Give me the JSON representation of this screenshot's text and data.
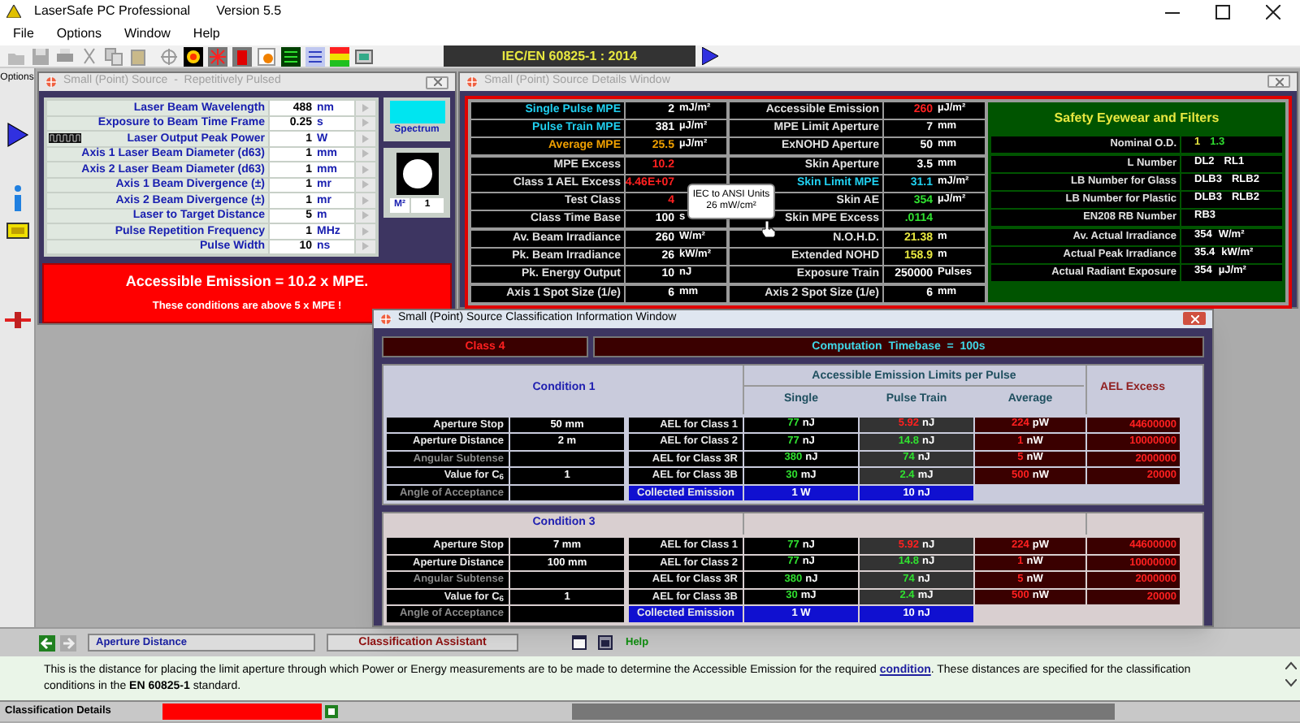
{
  "window": {
    "title": "LaserSafe PC Professional",
    "version": "Version 5.5"
  },
  "menu": [
    "File",
    "Options",
    "Window",
    "Help"
  ],
  "toolbar": {
    "standard": "IEC/EN 60825-1 : 2014"
  },
  "sidebar": {
    "label": "Options"
  },
  "source_window": {
    "title": "Small (Point) Source  -  Repetitively Pulsed",
    "parameters": [
      {
        "kind": "plain",
        "label": "Laser Beam Wavelength",
        "value": "488",
        "unit": "nm"
      },
      {
        "kind": "plain",
        "label": "Exposure to Beam Time Frame",
        "value": "0.25",
        "unit": "s"
      },
      {
        "kind": "pulse",
        "label": "Laser Output Peak Power",
        "value": "1",
        "unit": "W"
      },
      {
        "kind": "plain",
        "label": "Axis 1 Laser Beam Diameter (d63)",
        "value": "1",
        "unit": "mm"
      },
      {
        "kind": "plain",
        "label": "Axis 2 Laser Beam Diameter (d63)",
        "value": "1",
        "unit": "mm"
      },
      {
        "kind": "plain",
        "label": "Axis 1 Beam Divergence (±)",
        "value": "1",
        "unit": "mr"
      },
      {
        "kind": "plain",
        "label": "Axis 2 Beam Divergence (±)",
        "value": "1",
        "unit": "mr"
      },
      {
        "kind": "plain",
        "label": "Laser to Target Distance",
        "value": "5",
        "unit": "m"
      },
      {
        "kind": "plain",
        "label": "Pulse Repetition Frequency",
        "value": "1",
        "unit": "MHz"
      },
      {
        "kind": "plain",
        "label": "Pulse Width",
        "value": "10",
        "unit": "ns"
      }
    ],
    "spectrum": {
      "label": "Spectrum",
      "color": "#00e5f0"
    },
    "m2": {
      "label": "M²",
      "value": "1"
    },
    "alert": {
      "headline": "Accessible Emission = 10.2 x MPE.",
      "message": "These conditions are above 5 x MPE !"
    }
  },
  "details_window": {
    "title": "Small (Point) Source Details Window",
    "columns": [
      [
        [
          {
            "label": {
              "text": "Single Pulse MPE",
              "color": "#20d0f0"
            },
            "value": {
              "text": "2",
              "color": "#ffffff"
            },
            "unit": "mJ/m²"
          },
          {
            "label": {
              "text": "Pulse Train MPE",
              "color": "#20d0f0"
            },
            "value": {
              "text": "381",
              "color": "#ffffff"
            },
            "unit": "µJ/m²"
          },
          {
            "label": {
              "text": "Average MPE",
              "color": "#f0a000"
            },
            "value": {
              "text": "25.5",
              "color": "#f0a000"
            },
            "unit": "µJ/m²"
          }
        ],
        [
          {
            "label": {
              "text": "MPE Excess",
              "color": "#e0e0e0"
            },
            "value": {
              "text": "10.2",
              "color": "#ff2020"
            }
          },
          {
            "label": {
              "text": "Class 1 AEL Excess",
              "color": "#e0e0e0"
            },
            "value": {
              "text": "4.46E+07",
              "color": "#ff2020"
            }
          },
          {
            "label": {
              "text": "Test Class",
              "color": "#e0e0e0"
            },
            "value": {
              "text": "4",
              "color": "#ff2020"
            }
          },
          {
            "label": {
              "text": "Class Time Base",
              "color": "#e0e0e0"
            },
            "value": {
              "text": "100",
              "color": "#ffffff"
            },
            "unit": "s"
          }
        ],
        [
          {
            "label": {
              "text": "Av. Beam Irradiance",
              "color": "#e0e0e0"
            },
            "value": {
              "text": "260",
              "color": "#ffffff"
            },
            "unit": "W/m²"
          },
          {
            "label": {
              "text": "Pk. Beam Irradiance",
              "color": "#e0e0e0"
            },
            "value": {
              "text": "26",
              "color": "#ffffff"
            },
            "unit": "kW/m²"
          },
          {
            "label": {
              "text": "Pk. Energy Output",
              "color": "#e0e0e0"
            },
            "value": {
              "text": "10",
              "color": "#ffffff"
            },
            "unit": "nJ"
          }
        ],
        [
          {
            "label": {
              "text": "Axis 1 Spot Size  (1/e)",
              "color": "#e0e0e0"
            },
            "value": {
              "text": "6",
              "color": "#ffffff"
            },
            "unit": "mm"
          }
        ]
      ],
      [
        [
          {
            "label": {
              "text": "Accessible Emission",
              "color": "#e0e0e0"
            },
            "value": {
              "text": "260",
              "color": "#ff2020"
            },
            "unit": "µJ/m²"
          },
          {
            "label": {
              "text": "MPE Limit Aperture",
              "color": "#e0e0e0"
            },
            "value": {
              "text": "7",
              "color": "#ffffff"
            },
            "unit": "mm"
          },
          {
            "label": {
              "text": "ExNOHD Aperture",
              "color": "#e0e0e0"
            },
            "value": {
              "text": "50",
              "color": "#ffffff"
            },
            "unit": "mm"
          }
        ],
        [
          {
            "label": {
              "text": "Skin Aperture",
              "color": "#e0e0e0"
            },
            "value": {
              "text": "3.5",
              "color": "#ffffff"
            },
            "unit": "mm"
          },
          {
            "label": {
              "text": "Skin Limit MPE",
              "color": "#20d0f0"
            },
            "value": {
              "text": "31.1",
              "color": "#20d0f0"
            },
            "unit": "mJ/m²"
          },
          {
            "label": {
              "text": "Skin AE",
              "color": "#e0e0e0"
            },
            "value": {
              "text": "354",
              "color": "#30e030"
            },
            "unit": "µJ/m²"
          },
          {
            "label": {
              "text": "Skin MPE Excess",
              "color": "#e0e0e0"
            },
            "value": {
              "text": ".0114",
              "color": "#30e030"
            }
          }
        ],
        [
          {
            "label": {
              "text": "N.O.H.D.",
              "color": "#e0e0e0"
            },
            "value": {
              "text": "21.38",
              "color": "#e8e840"
            },
            "unit": "m"
          },
          {
            "label": {
              "text": "Extended NOHD",
              "color": "#e0e0e0"
            },
            "value": {
              "text": "158.9",
              "color": "#e8e840"
            },
            "unit": "m"
          },
          {
            "label": {
              "text": "Exposure Train",
              "color": "#e0e0e0"
            },
            "value": {
              "text": "250000",
              "color": "#ffffff"
            },
            "unit": "Pulses"
          }
        ],
        [
          {
            "label": {
              "text": "Axis 2 Spot Size  (1/e)",
              "color": "#e0e0e0"
            },
            "value": {
              "text": "6",
              "color": "#ffffff"
            },
            "unit": "mm"
          }
        ]
      ]
    ],
    "eyewear": {
      "title": "Safety Eyewear and Filters",
      "groups": [
        [
          {
            "label": "Nominal O.D.",
            "values": [
              {
                "text": "1",
                "color": "#e8e840"
              },
              {
                "text": "1.3",
                "color": "#30e030"
              }
            ]
          }
        ],
        [
          {
            "label": "L Number",
            "values": [
              {
                "text": "DL2",
                "color": "#ffffff"
              },
              {
                "text": "RL1",
                "color": "#ffffff"
              }
            ]
          },
          {
            "label": "LB Number for Glass",
            "values": [
              {
                "text": "DLB3",
                "color": "#ffffff"
              },
              {
                "text": "RLB2",
                "color": "#ffffff"
              }
            ]
          },
          {
            "label": "LB Number for Plastic",
            "values": [
              {
                "text": "DLB3",
                "color": "#ffffff"
              },
              {
                "text": "RLB2",
                "color": "#ffffff"
              }
            ]
          },
          {
            "label": "EN208 RB Number",
            "values": [
              {
                "text": "RB3",
                "color": "#ffffff"
              }
            ]
          }
        ],
        [
          {
            "label": "Av. Actual Irradiance",
            "values": [
              {
                "text": "354",
                "color": "#ffffff"
              }
            ],
            "unit": "W/m²"
          },
          {
            "label": "Actual Peak Irradiance",
            "values": [
              {
                "text": "35.4",
                "color": "#ffffff"
              }
            ],
            "unit": "kW/m²"
          },
          {
            "label": "Actual Radiant Exposure",
            "values": [
              {
                "text": "354",
                "color": "#ffffff"
              }
            ],
            "unit": "µJ/m²"
          }
        ]
      ]
    },
    "tooltip": {
      "title": "IEC to ANSI Units",
      "value": "26 mW/cm²"
    }
  },
  "classification_window": {
    "title": "Small (Point) Source Classification Information Window",
    "class": "Class 4",
    "timebase": "Computation  Timebase  =  100s",
    "conditions": [
      {
        "title": "Condition 1",
        "color": "#c9cbdc",
        "limits_header": "Accessible Emission Limits per Pulse",
        "columns": [
          "Single",
          "Pulse Train",
          "Average"
        ],
        "excess_header": "AEL Excess",
        "params": [
          {
            "label": "Aperture Stop",
            "value": "50 mm",
            "disabled": false
          },
          {
            "label": "Aperture Distance",
            "value": "2 m",
            "disabled": false
          },
          {
            "label": "Angular Subtense",
            "disabled": true
          },
          {
            "label": "Value for C$_{6}$",
            "value": "1",
            "disabled": false
          },
          {
            "label": "Angle of Acceptance",
            "disabled": true
          }
        ],
        "ael": [
          {
            "label": "AEL for Class 1",
            "single": {
              "value": "77",
              "unit": "nJ"
            },
            "pulse_train": {
              "value": "5.92",
              "unit": "nJ",
              "color": "#ff2020"
            },
            "average": {
              "value": "224",
              "unit": "pW"
            },
            "excess": "44600000"
          },
          {
            "label": "AEL for Class 2",
            "single": {
              "value": "77",
              "unit": "nJ"
            },
            "pulse_train": {
              "value": "14.8",
              "unit": "nJ",
              "color": "#30e030"
            },
            "average": {
              "value": "1",
              "unit": "nW"
            },
            "excess": "10000000"
          },
          {
            "label": "AEL for Class 3R",
            "single": {
              "value": "380",
              "unit": "nJ"
            },
            "pulse_train": {
              "value": "74",
              "unit": "nJ",
              "color": "#30e030"
            },
            "average": {
              "value": "5",
              "unit": "nW"
            },
            "excess": "2000000"
          },
          {
            "label": "AEL for Class 3B",
            "single": {
              "value": "30",
              "unit": "mJ"
            },
            "pulse_train": {
              "value": "2.4",
              "unit": "mJ",
              "color": "#30e030"
            },
            "average": {
              "value": "500",
              "unit": "nW"
            },
            "excess": "20000"
          }
        ],
        "collected": {
          "label": "Collected Emission",
          "single": "1 W",
          "pulse_train": "10 nJ"
        }
      },
      {
        "title": "Condition 3",
        "color": "#d9cfd0",
        "params": [
          {
            "label": "Aperture Stop",
            "value": "7 mm",
            "disabled": false
          },
          {
            "label": "Aperture Distance",
            "value": "100 mm",
            "disabled": false
          },
          {
            "label": "Angular Subtense",
            "disabled": true
          },
          {
            "label": "Value for C$_{6}$",
            "value": "1",
            "disabled": false
          },
          {
            "label": "Angle of Acceptance",
            "disabled": true
          }
        ],
        "ael": [
          {
            "label": "AEL for Class 1",
            "single": {
              "value": "77",
              "unit": "nJ"
            },
            "pulse_train": {
              "value": "5.92",
              "unit": "nJ",
              "color": "#ff2020"
            },
            "average": {
              "value": "224",
              "unit": "pW"
            },
            "excess": "44600000"
          },
          {
            "label": "AEL for Class 2",
            "single": {
              "value": "77",
              "unit": "nJ"
            },
            "pulse_train": {
              "value": "14.8",
              "unit": "nJ",
              "color": "#30e030"
            },
            "average": {
              "value": "1",
              "unit": "nW"
            },
            "excess": "10000000"
          },
          {
            "label": "AEL for Class 3R",
            "single": {
              "value": "380",
              "unit": "nJ"
            },
            "pulse_train": {
              "value": "74",
              "unit": "nJ",
              "color": "#30e030"
            },
            "average": {
              "value": "5",
              "unit": "nW"
            },
            "excess": "2000000"
          },
          {
            "label": "AEL for Class 3B",
            "single": {
              "value": "30",
              "unit": "mJ"
            },
            "pulse_train": {
              "value": "2.4",
              "unit": "mJ",
              "color": "#30e030"
            },
            "average": {
              "value": "500",
              "unit": "nW"
            },
            "excess": "20000"
          }
        ],
        "collected": {
          "label": "Collected Emission",
          "single": "1 W",
          "pulse_train": "10 nJ"
        }
      }
    ]
  },
  "nav": {
    "field": "Aperture Distance",
    "assistant": "Classification Assistant",
    "help": "Help"
  },
  "help_text": {
    "before": "This is the distance for placing the limit aperture through which Power or Energy measurements are to be made to determine the Accessible Emission for the required ",
    "link": "condition",
    "after": ".  These distances are specified for the classification conditions in the **EN 60825-1** standard."
  },
  "status_bar": {
    "label": "Classification Details"
  }
}
